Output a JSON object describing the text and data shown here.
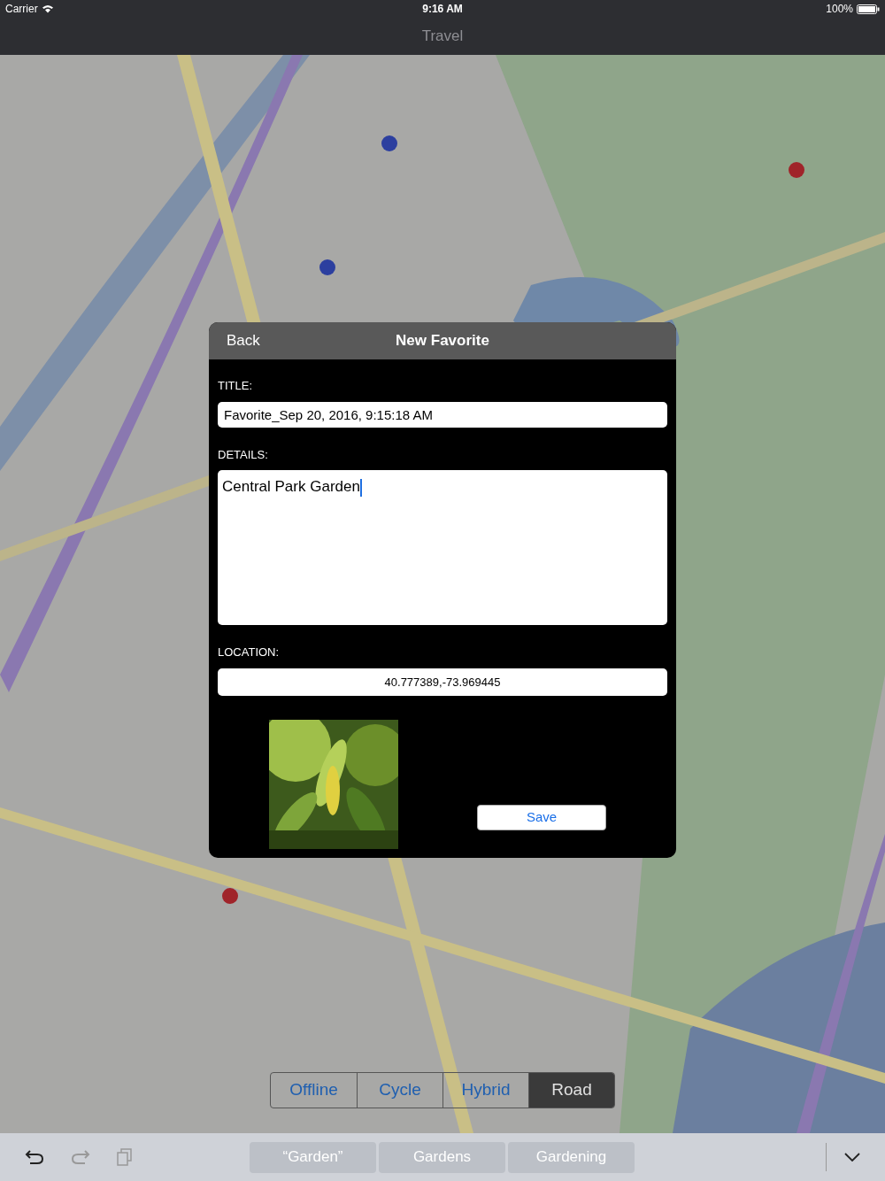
{
  "status_bar": {
    "carrier": "Carrier",
    "time": "9:16 AM",
    "battery": "100%"
  },
  "nav_bar": {
    "title": "Travel"
  },
  "dialog": {
    "back": "Back",
    "title": "New Favorite",
    "title_field": {
      "label": "TITLE:",
      "value": "Favorite_Sep 20, 2016, 9:15:18 AM"
    },
    "details_field": {
      "label": "DETAILS:",
      "value": "Central Park Garden",
      "focused": true
    },
    "location_field": {
      "label": "LOCATION:",
      "value": "40.777389,-73.969445"
    },
    "save": "Save"
  },
  "map_modes": [
    {
      "label": "Offline",
      "selected": false
    },
    {
      "label": "Cycle",
      "selected": false
    },
    {
      "label": "Hybrid",
      "selected": false
    },
    {
      "label": "Road",
      "selected": true
    }
  ],
  "keyboard_bar": {
    "suggestions": [
      "“Garden”",
      "Gardens",
      "Gardening"
    ]
  }
}
